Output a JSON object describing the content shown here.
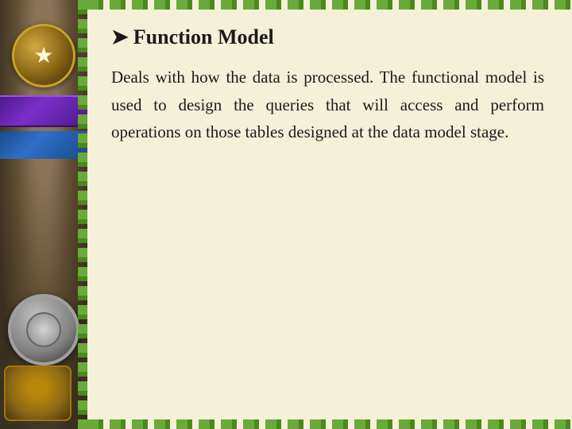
{
  "slide": {
    "heading_prefix": "➤",
    "heading": "Function Model",
    "body_text": "Deals with how the data is processed. The functional model is used to design the queries that will access and perform operations on those tables designed at the data model stage."
  },
  "colors": {
    "background": "#f5f0d8",
    "text": "#1a1a1a",
    "border_green": "#6aaa3a"
  }
}
